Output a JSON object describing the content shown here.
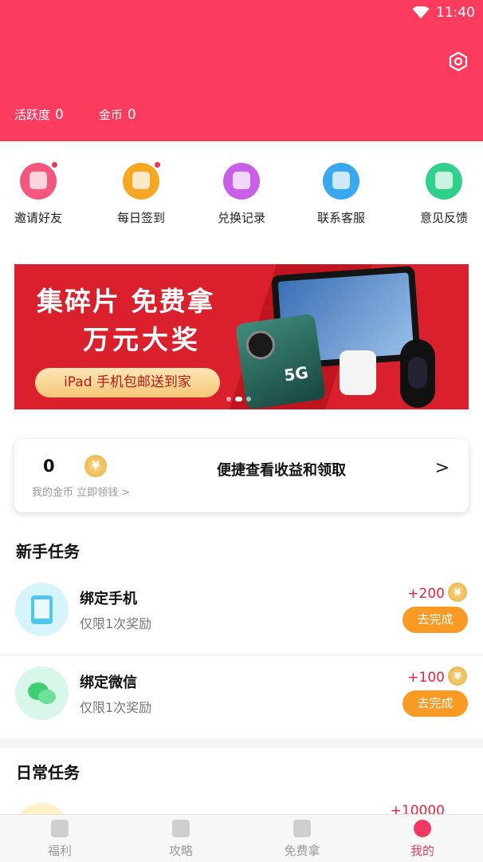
{
  "status_bar": {
    "time": "11:40",
    "wifi_icon": "wifi-icon"
  },
  "header": {
    "settings_icon": "hexagon-settings-icon",
    "activity_label": "活跃度",
    "activity_value": "0",
    "coins_label": "金币",
    "coins_value": "0",
    "bg_color": "#fb3c5e"
  },
  "quick_actions": [
    {
      "label": "邀请好友",
      "icon": "invite-gift-icon",
      "color": "#f5567d",
      "badge": true
    },
    {
      "label": "每日签到",
      "icon": "daily-checkin-icon",
      "color": "#f5a623",
      "badge": true
    },
    {
      "label": "兑换记录",
      "icon": "exchange-record-icon",
      "color": "#c85fe6",
      "badge": false
    },
    {
      "label": "联系客服",
      "icon": "customer-service-icon",
      "color": "#3aa8f0",
      "badge": false
    },
    {
      "label": "意见反馈",
      "icon": "feedback-icon",
      "color": "#2fd08c",
      "badge": false
    }
  ],
  "banner": {
    "title_line1": "集碎片 免费拿",
    "title_line2": "万元大奖",
    "button_text": "iPad 手机包邮送到家",
    "phone_badge": "5G",
    "slide_count": 3,
    "active_slide": 2
  },
  "earnings_card": {
    "value": "0",
    "coin_symbol": "¥",
    "sub_text": "我的金币 立即领钱 >",
    "main_text": "便捷查看收益和领取",
    "arrow": ">"
  },
  "newbie_section": {
    "title": "新手任务",
    "tasks": [
      {
        "name": "绑定手机",
        "desc": "仅限1次奖励",
        "reward": "+200",
        "button": "去完成",
        "icon": "bind-phone-icon",
        "color": "#d6f4fb"
      },
      {
        "name": "绑定微信",
        "desc": "仅限1次奖励",
        "reward": "+100",
        "button": "去完成",
        "icon": "wechat-icon",
        "color": "#d9f6ea"
      }
    ]
  },
  "daily_section": {
    "title": "日常任务",
    "partial_task_reward": "+10000"
  },
  "bottom_nav": [
    {
      "label": "福利",
      "icon": "gift-icon",
      "active": false
    },
    {
      "label": "攻略",
      "icon": "book-icon",
      "active": false
    },
    {
      "label": "免费拿",
      "icon": "free-box-icon",
      "active": false
    },
    {
      "label": "我的",
      "icon": "profile-icon",
      "active": true
    }
  ],
  "colors": {
    "accent": "#fb3c5e",
    "button_orange": "#f99a25",
    "reward_red": "#e8243e"
  }
}
